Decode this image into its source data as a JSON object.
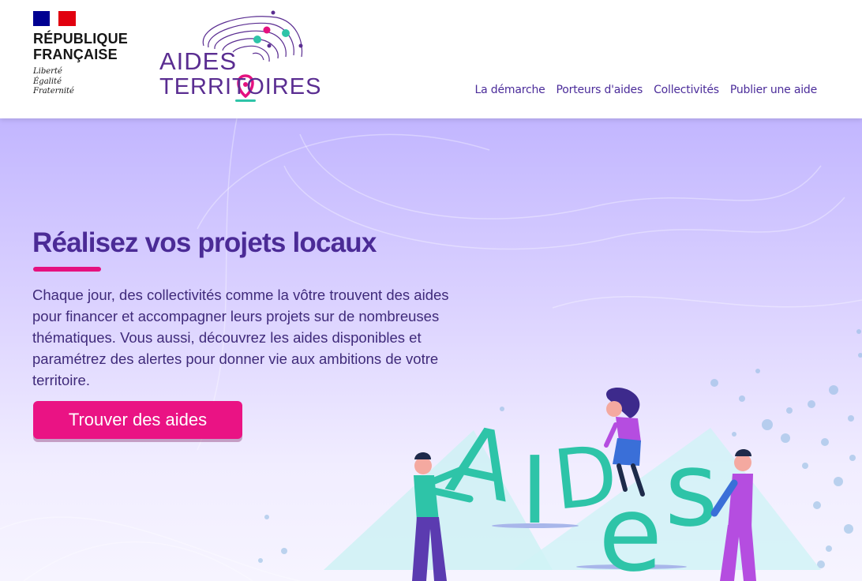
{
  "header": {
    "republique": {
      "title": "RÉPUBLIQUE\nFRANÇAISE",
      "motto": "Liberté\nÉgalité\nFraternité"
    },
    "brand": {
      "line1": "AIDES",
      "line2": "TERRITOIRES"
    },
    "nav": [
      "La démarche",
      "Porteurs d'aides",
      "Collectivités",
      "Publier une aide"
    ]
  },
  "hero": {
    "title": "Réalisez vos projets locaux",
    "text": "Chaque jour, des collectivités comme la vôtre trouvent des aides pour financer et accompagner leurs projets sur de nombreuses thématiques. Vous aussi, découvrez les aides disponibles et paramétrez des alertes pour donner vie aux ambitions de votre territoire.",
    "cta": "Trouver des aides",
    "illustration_letters": [
      "A",
      "I",
      "D",
      "e",
      "s"
    ]
  },
  "colors": {
    "primary": "#4b2b96",
    "accent": "#e5117f",
    "teal": "#2ec4a8",
    "hero_bg": "#c2b6ff"
  }
}
